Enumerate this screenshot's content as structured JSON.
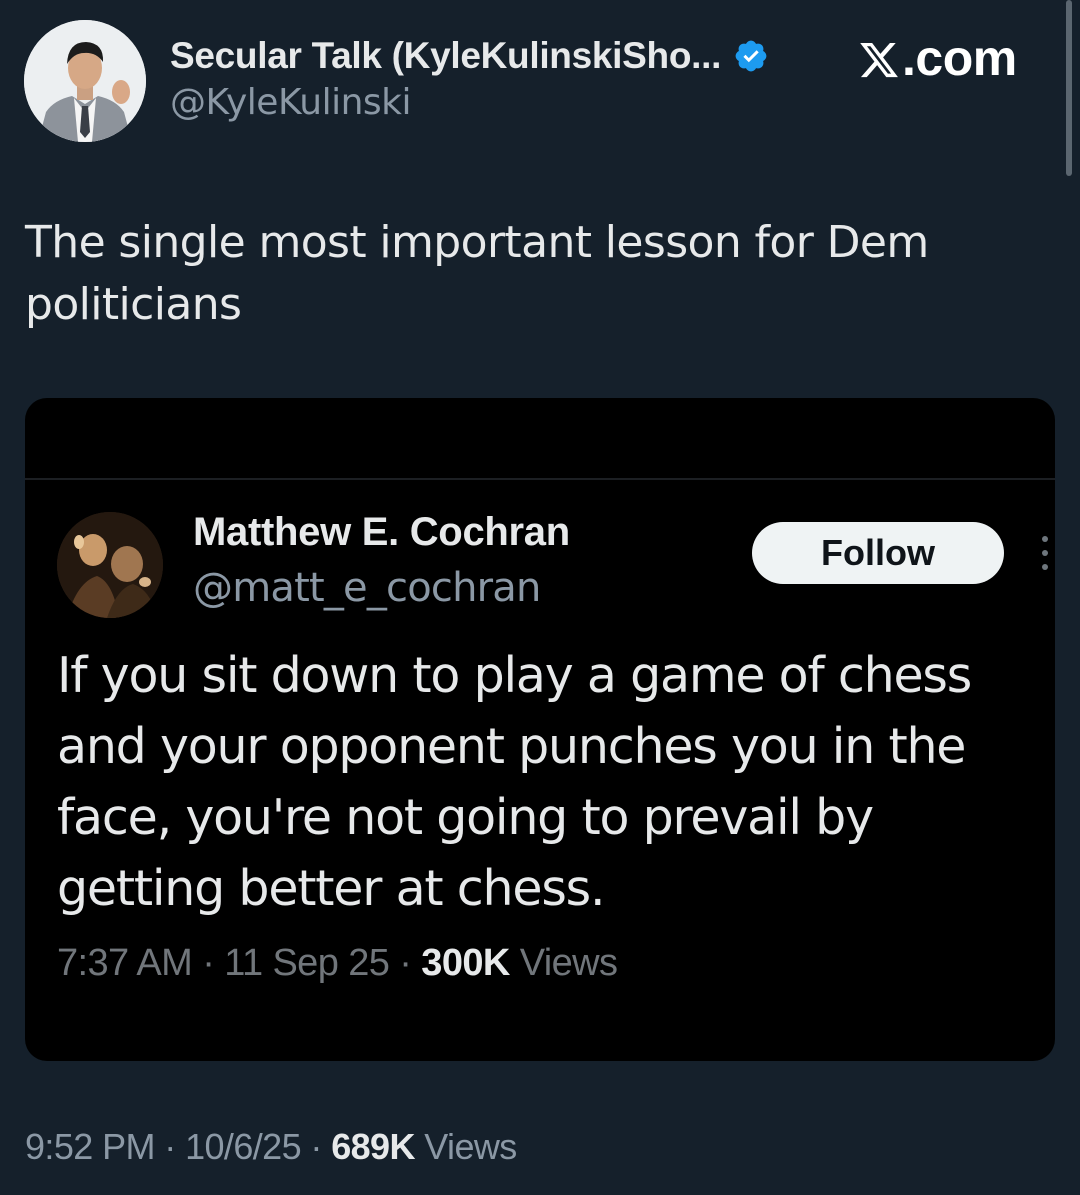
{
  "header": {
    "author_name": "Secular Talk (KyleKulinskiSho...",
    "author_handle": "@KyleKulinski",
    "site_label": ".com",
    "site_logo": "x-logo-icon",
    "verified_badge": "verified-icon",
    "verified_color": "#1d9bf0"
  },
  "tweet": {
    "text": "The single most important lesson for Dem politicians",
    "time": "9:52 PM",
    "separator_1": "·",
    "date": "10/6/25",
    "separator_2": "·",
    "views_count": "689K",
    "views_label": "Views"
  },
  "embedded_tweet": {
    "author_name": "Matthew E. Cochran",
    "author_handle": "@matt_e_cochran",
    "follow_label": "Follow",
    "more_icon": "more-vertical-icon",
    "text": "If you sit down to play a game of chess and your opponent punches you in the face, you're not going to prevail by getting better at chess.",
    "time": "7:37 AM",
    "separator_1": "·",
    "date": "11 Sep 25",
    "separator_2": "·",
    "views_count": "300K",
    "views_label": "Views"
  },
  "colors": {
    "background": "#15202b",
    "embed_background": "#000000",
    "primary_text": "#e7e9ea",
    "secondary_text": "#8b98a5",
    "follow_button_bg": "#eff3f4"
  }
}
